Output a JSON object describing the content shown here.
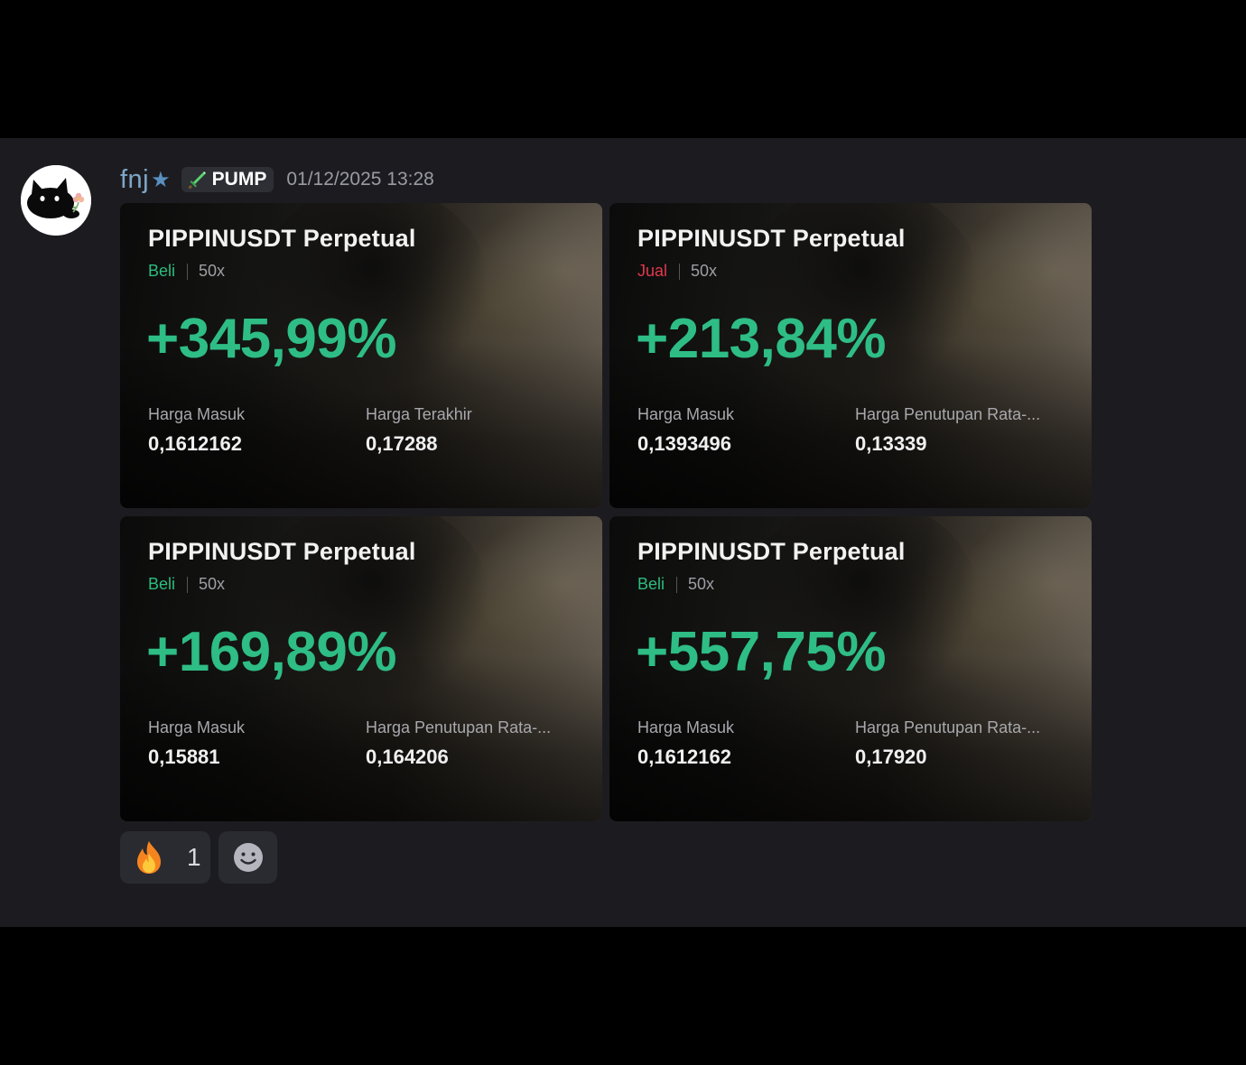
{
  "message": {
    "author": "fnj",
    "author_star": "★",
    "tag_label": "PUMP",
    "timestamp": "01/12/2025 13:28"
  },
  "colors": {
    "profit": "#2ebd85",
    "buy": "#2bbd7e",
    "sell": "#e0394c",
    "username": "#7fa6c7"
  },
  "cards": [
    {
      "pair": "PIPPINUSDT Perpetual",
      "side": "Beli",
      "leverage": "50x",
      "pnl": "+345,99%",
      "label1": "Harga Masuk",
      "value1": "0,1612162",
      "label2": "Harga Terakhir",
      "value2": "0,17288"
    },
    {
      "pair": "PIPPINUSDT Perpetual",
      "side": "Jual",
      "leverage": "50x",
      "pnl": "+213,84%",
      "label1": "Harga Masuk",
      "value1": "0,1393496",
      "label2": "Harga Penutupan Rata-...",
      "value2": "0,13339"
    },
    {
      "pair": "PIPPINUSDT Perpetual",
      "side": "Beli",
      "leverage": "50x",
      "pnl": "+169,89%",
      "label1": "Harga Masuk",
      "value1": "0,15881",
      "label2": "Harga Penutupan Rata-...",
      "value2": "0,164206"
    },
    {
      "pair": "PIPPINUSDT Perpetual",
      "side": "Beli",
      "leverage": "50x",
      "pnl": "+557,75%",
      "label1": "Harga Masuk",
      "value1": "0,1612162",
      "label2": "Harga Penutupan Rata-...",
      "value2": "0,17920"
    }
  ],
  "reactions": {
    "fire_icon": "fire-emoji",
    "fire_count": "1",
    "add_icon": "add-reaction-smiley"
  }
}
